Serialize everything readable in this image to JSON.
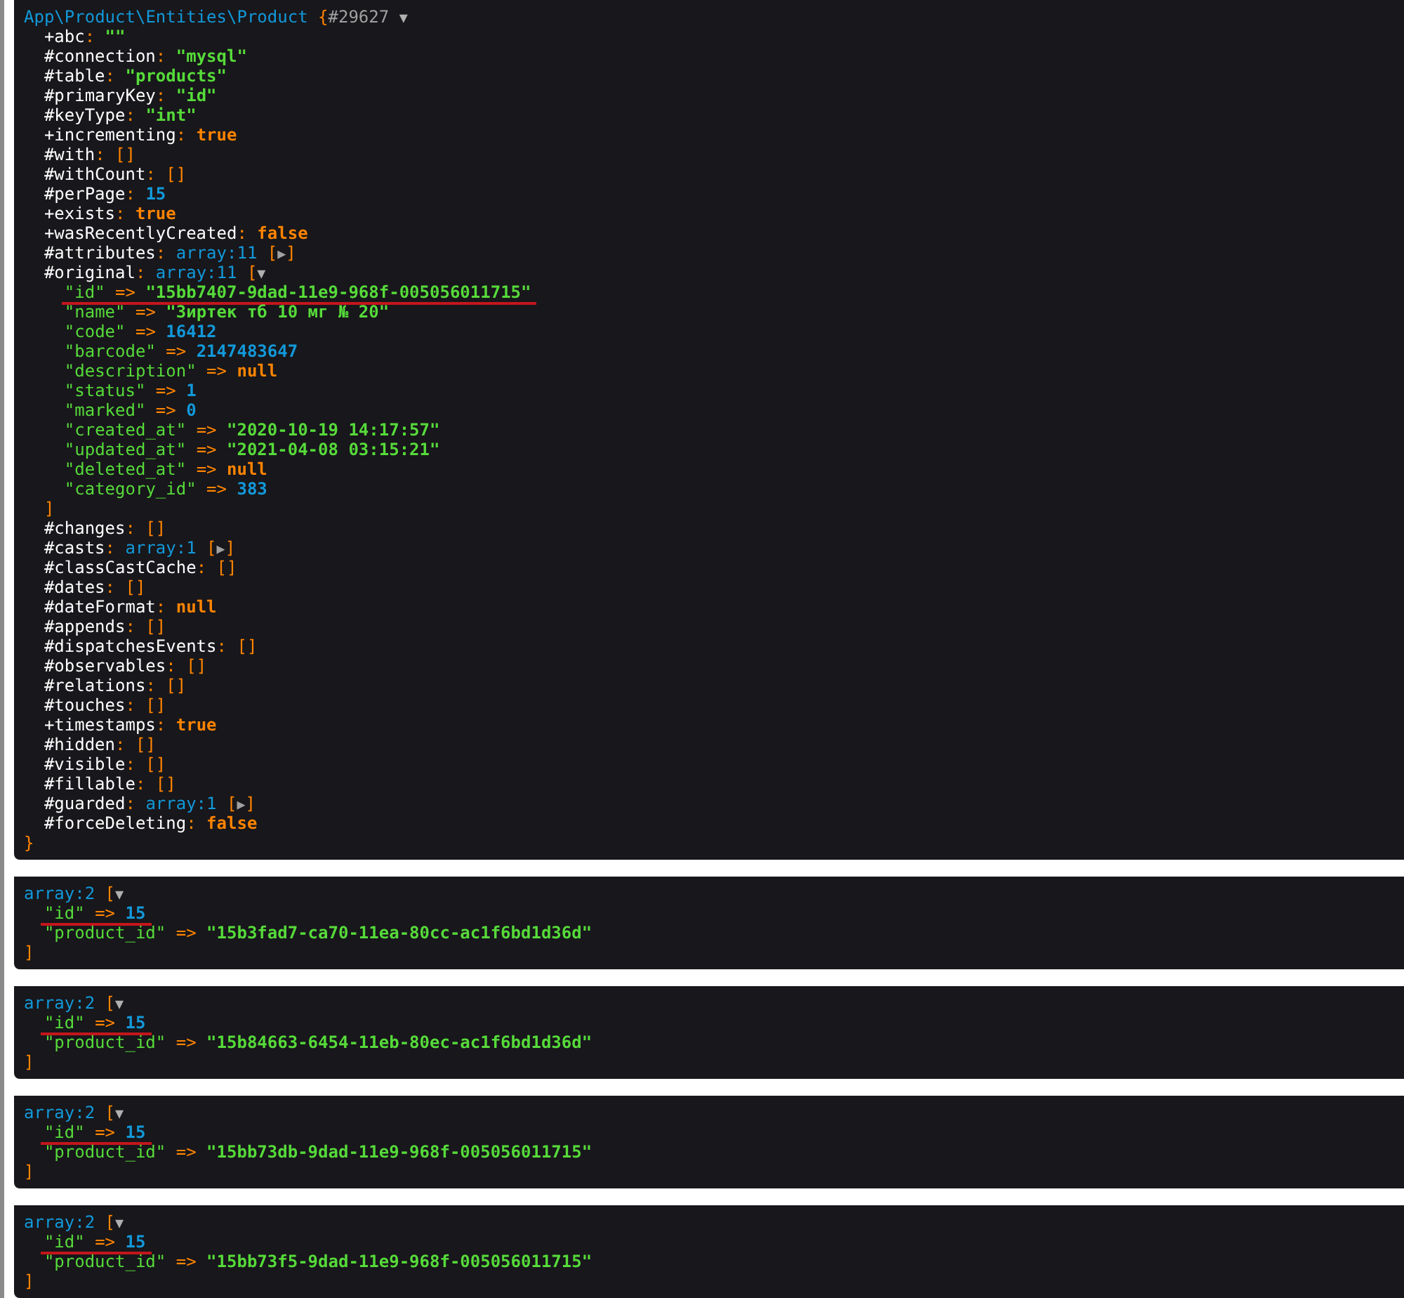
{
  "dumps": [
    {
      "lines": [
        {
          "tokens": [
            {
              "kind": "note",
              "text": "App\\Product\\Entities\\Product"
            },
            {
              "kind": "punct",
              "text": " {"
            },
            {
              "kind": "ref",
              "text": "#29627 "
            },
            {
              "kind": "toggle",
              "text": "▼"
            }
          ],
          "expanded": true,
          "close": [
            {
              "kind": "punct",
              "text": "}"
            }
          ],
          "children": [
            {
              "tokens": [
                {
                  "kind": "key",
                  "text": "+abc"
                },
                {
                  "kind": "punct",
                  "text": ": "
                },
                {
                  "kind": "str",
                  "text": "\"\""
                }
              ]
            },
            {
              "tokens": [
                {
                  "kind": "key",
                  "text": "#connection"
                },
                {
                  "kind": "punct",
                  "text": ": "
                },
                {
                  "kind": "str",
                  "text": "\"mysql\""
                }
              ]
            },
            {
              "tokens": [
                {
                  "kind": "key",
                  "text": "#table"
                },
                {
                  "kind": "punct",
                  "text": ": "
                },
                {
                  "kind": "str",
                  "text": "\"products\""
                }
              ]
            },
            {
              "tokens": [
                {
                  "kind": "key",
                  "text": "#primaryKey"
                },
                {
                  "kind": "punct",
                  "text": ": "
                },
                {
                  "kind": "str",
                  "text": "\"id\""
                }
              ]
            },
            {
              "tokens": [
                {
                  "kind": "key",
                  "text": "#keyType"
                },
                {
                  "kind": "punct",
                  "text": ": "
                },
                {
                  "kind": "str",
                  "text": "\"int\""
                }
              ]
            },
            {
              "tokens": [
                {
                  "kind": "key",
                  "text": "+incrementing"
                },
                {
                  "kind": "punct",
                  "text": ": "
                },
                {
                  "kind": "const",
                  "text": "true"
                }
              ]
            },
            {
              "tokens": [
                {
                  "kind": "key",
                  "text": "#with"
                },
                {
                  "kind": "punct",
                  "text": ": []"
                }
              ]
            },
            {
              "tokens": [
                {
                  "kind": "key",
                  "text": "#withCount"
                },
                {
                  "kind": "punct",
                  "text": ": []"
                }
              ]
            },
            {
              "tokens": [
                {
                  "kind": "key",
                  "text": "#perPage"
                },
                {
                  "kind": "punct",
                  "text": ": "
                },
                {
                  "kind": "num",
                  "text": "15"
                }
              ]
            },
            {
              "tokens": [
                {
                  "kind": "key",
                  "text": "+exists"
                },
                {
                  "kind": "punct",
                  "text": ": "
                },
                {
                  "kind": "const",
                  "text": "true"
                }
              ]
            },
            {
              "tokens": [
                {
                  "kind": "key",
                  "text": "+wasRecentlyCreated"
                },
                {
                  "kind": "punct",
                  "text": ": "
                },
                {
                  "kind": "const",
                  "text": "false"
                }
              ]
            },
            {
              "tokens": [
                {
                  "kind": "key",
                  "text": "#attributes"
                },
                {
                  "kind": "punct",
                  "text": ": "
                },
                {
                  "kind": "note",
                  "text": "array:11"
                },
                {
                  "kind": "punct",
                  "text": " ["
                },
                {
                  "kind": "toggle",
                  "text": "▶"
                },
                {
                  "kind": "punct",
                  "text": "]"
                }
              ],
              "expanded": false
            },
            {
              "tokens": [
                {
                  "kind": "key",
                  "text": "#original"
                },
                {
                  "kind": "punct",
                  "text": ": "
                },
                {
                  "kind": "note",
                  "text": "array:11"
                },
                {
                  "kind": "punct",
                  "text": " ["
                },
                {
                  "kind": "toggle",
                  "text": "▼"
                }
              ],
              "expanded": true,
              "close": [
                {
                  "kind": "punct",
                  "text": "]"
                }
              ],
              "children": [
                {
                  "tokens": [
                    {
                      "kind": "ikey",
                      "text": "\"id\""
                    },
                    {
                      "kind": "punct",
                      "text": " => "
                    },
                    {
                      "kind": "str",
                      "text": "\"15bb7407-9dad-11e9-968f-005056011715\""
                    }
                  ],
                  "underlined": true
                },
                {
                  "tokens": [
                    {
                      "kind": "ikey",
                      "text": "\"name\""
                    },
                    {
                      "kind": "punct",
                      "text": " => "
                    },
                    {
                      "kind": "str",
                      "text": "\"Зиртек тб 10 мг № 20\""
                    }
                  ],
                  "underlined": false
                },
                {
                  "tokens": [
                    {
                      "kind": "ikey",
                      "text": "\"code\""
                    },
                    {
                      "kind": "punct",
                      "text": " => "
                    },
                    {
                      "kind": "num",
                      "text": "16412"
                    }
                  ],
                  "underlined": false
                },
                {
                  "tokens": [
                    {
                      "kind": "ikey",
                      "text": "\"barcode\""
                    },
                    {
                      "kind": "punct",
                      "text": " => "
                    },
                    {
                      "kind": "num",
                      "text": "2147483647"
                    }
                  ],
                  "underlined": false
                },
                {
                  "tokens": [
                    {
                      "kind": "ikey",
                      "text": "\"description\""
                    },
                    {
                      "kind": "punct",
                      "text": " => "
                    },
                    {
                      "kind": "const",
                      "text": "null"
                    }
                  ],
                  "underlined": false
                },
                {
                  "tokens": [
                    {
                      "kind": "ikey",
                      "text": "\"status\""
                    },
                    {
                      "kind": "punct",
                      "text": " => "
                    },
                    {
                      "kind": "num",
                      "text": "1"
                    }
                  ],
                  "underlined": false
                },
                {
                  "tokens": [
                    {
                      "kind": "ikey",
                      "text": "\"marked\""
                    },
                    {
                      "kind": "punct",
                      "text": " => "
                    },
                    {
                      "kind": "num",
                      "text": "0"
                    }
                  ],
                  "underlined": false
                },
                {
                  "tokens": [
                    {
                      "kind": "ikey",
                      "text": "\"created_at\""
                    },
                    {
                      "kind": "punct",
                      "text": " => "
                    },
                    {
                      "kind": "str",
                      "text": "\"2020-10-19 14:17:57\""
                    }
                  ],
                  "underlined": false
                },
                {
                  "tokens": [
                    {
                      "kind": "ikey",
                      "text": "\"updated_at\""
                    },
                    {
                      "kind": "punct",
                      "text": " => "
                    },
                    {
                      "kind": "str",
                      "text": "\"2021-04-08 03:15:21\""
                    }
                  ],
                  "underlined": false
                },
                {
                  "tokens": [
                    {
                      "kind": "ikey",
                      "text": "\"deleted_at\""
                    },
                    {
                      "kind": "punct",
                      "text": " => "
                    },
                    {
                      "kind": "const",
                      "text": "null"
                    }
                  ],
                  "underlined": false
                },
                {
                  "tokens": [
                    {
                      "kind": "ikey",
                      "text": "\"category_id\""
                    },
                    {
                      "kind": "punct",
                      "text": " => "
                    },
                    {
                      "kind": "num",
                      "text": "383"
                    }
                  ],
                  "underlined": false
                }
              ]
            },
            {
              "tokens": [
                {
                  "kind": "key",
                  "text": "#changes"
                },
                {
                  "kind": "punct",
                  "text": ": []"
                }
              ]
            },
            {
              "tokens": [
                {
                  "kind": "key",
                  "text": "#casts"
                },
                {
                  "kind": "punct",
                  "text": ": "
                },
                {
                  "kind": "note",
                  "text": "array:1"
                },
                {
                  "kind": "punct",
                  "text": " ["
                },
                {
                  "kind": "toggle",
                  "text": "▶"
                },
                {
                  "kind": "punct",
                  "text": "]"
                }
              ],
              "expanded": false
            },
            {
              "tokens": [
                {
                  "kind": "key",
                  "text": "#classCastCache"
                },
                {
                  "kind": "punct",
                  "text": ": []"
                }
              ]
            },
            {
              "tokens": [
                {
                  "kind": "key",
                  "text": "#dates"
                },
                {
                  "kind": "punct",
                  "text": ": []"
                }
              ]
            },
            {
              "tokens": [
                {
                  "kind": "key",
                  "text": "#dateFormat"
                },
                {
                  "kind": "punct",
                  "text": ": "
                },
                {
                  "kind": "const",
                  "text": "null"
                }
              ]
            },
            {
              "tokens": [
                {
                  "kind": "key",
                  "text": "#appends"
                },
                {
                  "kind": "punct",
                  "text": ": []"
                }
              ]
            },
            {
              "tokens": [
                {
                  "kind": "key",
                  "text": "#dispatchesEvents"
                },
                {
                  "kind": "punct",
                  "text": ": []"
                }
              ]
            },
            {
              "tokens": [
                {
                  "kind": "key",
                  "text": "#observables"
                },
                {
                  "kind": "punct",
                  "text": ": []"
                }
              ]
            },
            {
              "tokens": [
                {
                  "kind": "key",
                  "text": "#relations"
                },
                {
                  "kind": "punct",
                  "text": ": []"
                }
              ]
            },
            {
              "tokens": [
                {
                  "kind": "key",
                  "text": "#touches"
                },
                {
                  "kind": "punct",
                  "text": ": []"
                }
              ]
            },
            {
              "tokens": [
                {
                  "kind": "key",
                  "text": "+timestamps"
                },
                {
                  "kind": "punct",
                  "text": ": "
                },
                {
                  "kind": "const",
                  "text": "true"
                }
              ]
            },
            {
              "tokens": [
                {
                  "kind": "key",
                  "text": "#hidden"
                },
                {
                  "kind": "punct",
                  "text": ": []"
                }
              ]
            },
            {
              "tokens": [
                {
                  "kind": "key",
                  "text": "#visible"
                },
                {
                  "kind": "punct",
                  "text": ": []"
                }
              ]
            },
            {
              "tokens": [
                {
                  "kind": "key",
                  "text": "#fillable"
                },
                {
                  "kind": "punct",
                  "text": ": []"
                }
              ]
            },
            {
              "tokens": [
                {
                  "kind": "key",
                  "text": "#guarded"
                },
                {
                  "kind": "punct",
                  "text": ": "
                },
                {
                  "kind": "note",
                  "text": "array:1"
                },
                {
                  "kind": "punct",
                  "text": " ["
                },
                {
                  "kind": "toggle",
                  "text": "▶"
                },
                {
                  "kind": "punct",
                  "text": "]"
                }
              ],
              "expanded": false
            },
            {
              "tokens": [
                {
                  "kind": "key",
                  "text": "#forceDeleting"
                },
                {
                  "kind": "punct",
                  "text": ": "
                },
                {
                  "kind": "const",
                  "text": "false"
                }
              ]
            }
          ]
        }
      ]
    },
    {
      "lines": [
        {
          "tokens": [
            {
              "kind": "note",
              "text": "array:2"
            },
            {
              "kind": "punct",
              "text": " ["
            },
            {
              "kind": "toggle",
              "text": "▼"
            }
          ],
          "expanded": true,
          "close": [
            {
              "kind": "punct",
              "text": "]"
            }
          ],
          "children": [
            {
              "tokens": [
                {
                  "kind": "ikey",
                  "text": "\"id\""
                },
                {
                  "kind": "punct",
                  "text": " => "
                },
                {
                  "kind": "num",
                  "text": "15"
                }
              ],
              "underlined": true
            },
            {
              "tokens": [
                {
                  "kind": "ikey",
                  "text": "\"product_id\""
                },
                {
                  "kind": "punct",
                  "text": " => "
                },
                {
                  "kind": "str",
                  "text": "\"15b3fad7-ca70-11ea-80cc-ac1f6bd1d36d\""
                }
              ],
              "underlined": false
            }
          ]
        }
      ]
    },
    {
      "lines": [
        {
          "tokens": [
            {
              "kind": "note",
              "text": "array:2"
            },
            {
              "kind": "punct",
              "text": " ["
            },
            {
              "kind": "toggle",
              "text": "▼"
            }
          ],
          "expanded": true,
          "close": [
            {
              "kind": "punct",
              "text": "]"
            }
          ],
          "children": [
            {
              "tokens": [
                {
                  "kind": "ikey",
                  "text": "\"id\""
                },
                {
                  "kind": "punct",
                  "text": " => "
                },
                {
                  "kind": "num",
                  "text": "15"
                }
              ],
              "underlined": true
            },
            {
              "tokens": [
                {
                  "kind": "ikey",
                  "text": "\"product_id\""
                },
                {
                  "kind": "punct",
                  "text": " => "
                },
                {
                  "kind": "str",
                  "text": "\"15b84663-6454-11eb-80ec-ac1f6bd1d36d\""
                }
              ],
              "underlined": false
            }
          ]
        }
      ]
    },
    {
      "lines": [
        {
          "tokens": [
            {
              "kind": "note",
              "text": "array:2"
            },
            {
              "kind": "punct",
              "text": " ["
            },
            {
              "kind": "toggle",
              "text": "▼"
            }
          ],
          "expanded": true,
          "close": [
            {
              "kind": "punct",
              "text": "]"
            }
          ],
          "children": [
            {
              "tokens": [
                {
                  "kind": "ikey",
                  "text": "\"id\""
                },
                {
                  "kind": "punct",
                  "text": " => "
                },
                {
                  "kind": "num",
                  "text": "15"
                }
              ],
              "underlined": true
            },
            {
              "tokens": [
                {
                  "kind": "ikey",
                  "text": "\"product_id\""
                },
                {
                  "kind": "punct",
                  "text": " => "
                },
                {
                  "kind": "str",
                  "text": "\"15bb73db-9dad-11e9-968f-005056011715\""
                }
              ],
              "underlined": false
            }
          ]
        }
      ]
    },
    {
      "lines": [
        {
          "tokens": [
            {
              "kind": "note",
              "text": "array:2"
            },
            {
              "kind": "punct",
              "text": " ["
            },
            {
              "kind": "toggle",
              "text": "▼"
            }
          ],
          "expanded": true,
          "close": [
            {
              "kind": "punct",
              "text": "]"
            }
          ],
          "children": [
            {
              "tokens": [
                {
                  "kind": "ikey",
                  "text": "\"id\""
                },
                {
                  "kind": "punct",
                  "text": " => "
                },
                {
                  "kind": "num",
                  "text": "15"
                }
              ],
              "underlined": true
            },
            {
              "tokens": [
                {
                  "kind": "ikey",
                  "text": "\"product_id\""
                },
                {
                  "kind": "punct",
                  "text": " => "
                },
                {
                  "kind": "str",
                  "text": "\"15bb73f5-9dad-11e9-968f-005056011715\""
                }
              ],
              "underlined": false
            }
          ]
        }
      ]
    }
  ]
}
